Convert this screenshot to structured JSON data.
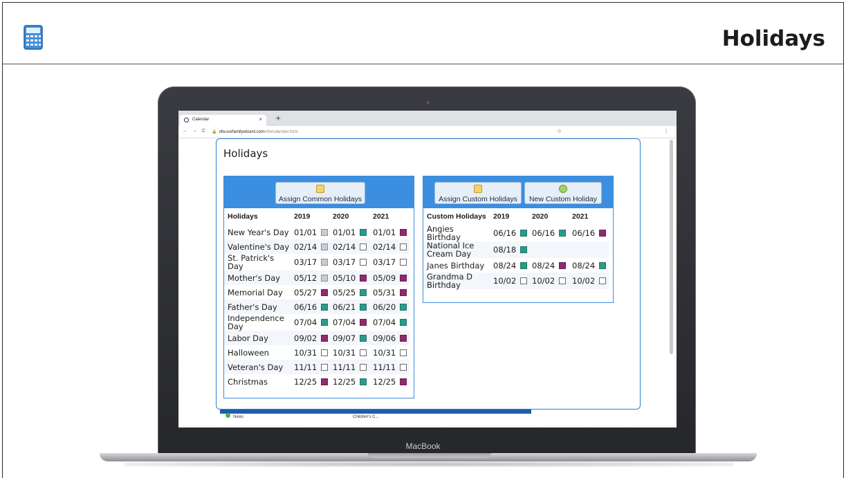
{
  "slide": {
    "title": "Holidays",
    "icon": "calculator-icon"
  },
  "laptop": {
    "brand": "MacBook"
  },
  "browser": {
    "tab_title": "Calendar",
    "tab_close": "×",
    "new_tab": "+",
    "url_host": "ofw.ourfamilywizard.com",
    "url_path": "/ofw/calendar.form",
    "nav_back": "←",
    "nav_forward": "→",
    "nav_reload": "C",
    "bookmark": "☆",
    "menu": "⋮"
  },
  "background_page": {
    "item1": "News",
    "item2": "Children's C..."
  },
  "modal": {
    "title": "Holidays",
    "common": {
      "assign_button": "Assign Common Holidays",
      "headers": [
        "Holidays",
        "2019",
        "2020",
        "2021"
      ],
      "rows": [
        {
          "name": "New Year's Day",
          "d2019": "01/01",
          "c2019": "gray",
          "d2020": "01/01",
          "c2020": "teal",
          "d2021": "01/01",
          "c2021": "purple"
        },
        {
          "name": "Valentine's Day",
          "d2019": "02/14",
          "c2019": "gray",
          "d2020": "02/14",
          "c2020": "white",
          "d2021": "02/14",
          "c2021": "white"
        },
        {
          "name": "St. Patrick's Day",
          "d2019": "03/17",
          "c2019": "gray",
          "d2020": "03/17",
          "c2020": "white",
          "d2021": "03/17",
          "c2021": "white"
        },
        {
          "name": "Mother's Day",
          "d2019": "05/12",
          "c2019": "gray",
          "d2020": "05/10",
          "c2020": "purple",
          "d2021": "05/09",
          "c2021": "purple"
        },
        {
          "name": "Memorial Day",
          "d2019": "05/27",
          "c2019": "purple",
          "d2020": "05/25",
          "c2020": "teal",
          "d2021": "05/31",
          "c2021": "purple"
        },
        {
          "name": "Father's Day",
          "d2019": "06/16",
          "c2019": "teal",
          "d2020": "06/21",
          "c2020": "teal",
          "d2021": "06/20",
          "c2021": "teal"
        },
        {
          "name": "Independence Day",
          "d2019": "07/04",
          "c2019": "teal",
          "d2020": "07/04",
          "c2020": "purple",
          "d2021": "07/04",
          "c2021": "teal"
        },
        {
          "name": "Labor Day",
          "d2019": "09/02",
          "c2019": "purple",
          "d2020": "09/07",
          "c2020": "teal",
          "d2021": "09/06",
          "c2021": "purple"
        },
        {
          "name": "Halloween",
          "d2019": "10/31",
          "c2019": "white",
          "d2020": "10/31",
          "c2020": "white",
          "d2021": "10/31",
          "c2021": "white"
        },
        {
          "name": "Veteran's Day",
          "d2019": "11/11",
          "c2019": "white",
          "d2020": "11/11",
          "c2020": "white",
          "d2021": "11/11",
          "c2021": "white"
        },
        {
          "name": "Christmas",
          "d2019": "12/25",
          "c2019": "purple",
          "d2020": "12/25",
          "c2020": "teal",
          "d2021": "12/25",
          "c2021": "purple"
        }
      ]
    },
    "custom": {
      "assign_button": "Assign Custom Holidays",
      "new_button": "New Custom Holiday",
      "headers": [
        "Custom Holidays",
        "2019",
        "2020",
        "2021"
      ],
      "rows": [
        {
          "name": "Angies Birthday",
          "d2019": "06/16",
          "c2019": "teal",
          "d2020": "06/16",
          "c2020": "teal",
          "d2021": "06/16",
          "c2021": "purple"
        },
        {
          "name": "National Ice Cream Day",
          "d2019": "08/18",
          "c2019": "teal",
          "d2020": "",
          "c2020": "",
          "d2021": "",
          "c2021": ""
        },
        {
          "name": "Janes Birthday",
          "d2019": "08/24",
          "c2019": "teal",
          "d2020": "08/24",
          "c2020": "purple",
          "d2021": "08/24",
          "c2021": "teal"
        },
        {
          "name": "Grandma D Birthday",
          "d2019": "10/02",
          "c2019": "white",
          "d2020": "10/02",
          "c2020": "white",
          "d2021": "10/02",
          "c2021": "white"
        }
      ]
    }
  },
  "colors": {
    "panel_header": "#3b8ee0",
    "swatch_teal": "#2a9b8a",
    "swatch_purple": "#8e2b6e",
    "swatch_gray": "#c9ccd3"
  }
}
